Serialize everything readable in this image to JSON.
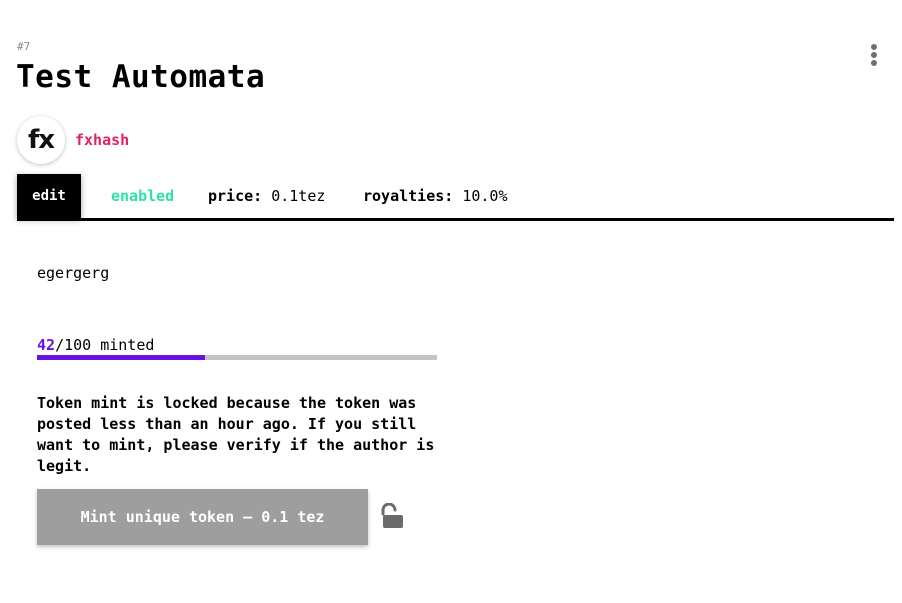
{
  "token": {
    "id": "#7",
    "title": "Test Automata"
  },
  "author": {
    "avatar_text": "fx",
    "name": "fxhash"
  },
  "info_bar": {
    "edit_label": "edit",
    "status": "enabled",
    "price_label": "price:",
    "price_value": "0.1tez",
    "royalties_label": "royalties:",
    "royalties_value": "10.0%"
  },
  "description": "egergerg",
  "mint_progress": {
    "minted": "42",
    "suffix": "/100 minted",
    "fraction": 0.42,
    "fill_color": "#6a11e8",
    "track_color": "#c4c4c4"
  },
  "warning_text": "Token mint is locked because the token was posted less than an hour ago. If you still want to mint, please verify if the author is legit.",
  "mint_button": {
    "label": "Mint unique token — 0.1 tez"
  },
  "icons": {
    "menu": "more-vertical-icon",
    "lock": "unlocked-padlock-icon"
  },
  "colors": {
    "author": "#e0245e",
    "enabled": "#2ee2a6",
    "accent": "#6a11e8",
    "button_disabled": "#9e9e9e"
  }
}
